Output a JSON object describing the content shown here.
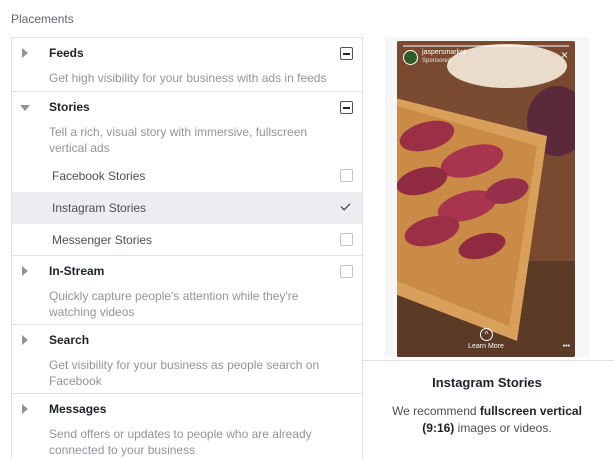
{
  "header": "Placements",
  "feeds": {
    "title": "Feeds",
    "description": "Get high visibility for your business with ads in feeds"
  },
  "stories": {
    "title": "Stories",
    "description": "Tell a rich, visual story with immersive, fullscreen vertical ads",
    "items": [
      {
        "label": "Facebook Stories",
        "checked": false
      },
      {
        "label": "Instagram Stories",
        "checked": true
      },
      {
        "label": "Messenger Stories",
        "checked": false
      }
    ]
  },
  "instream": {
    "title": "In-Stream",
    "description": "Quickly capture people's attention while they're watching videos"
  },
  "search": {
    "title": "Search",
    "description": "Get visibility for your business as people search on Facebook"
  },
  "messages": {
    "title": "Messages",
    "description": "Send offers or updates to people who are already connected to your business"
  },
  "preview": {
    "account": "jaspersmarket",
    "sponsored": "Sponsored",
    "cta": "Learn More",
    "title": "Instagram Stories",
    "rec_prefix": "We recommend ",
    "rec_bold": "fullscreen vertical (9:16)",
    "rec_suffix": " images or videos."
  }
}
